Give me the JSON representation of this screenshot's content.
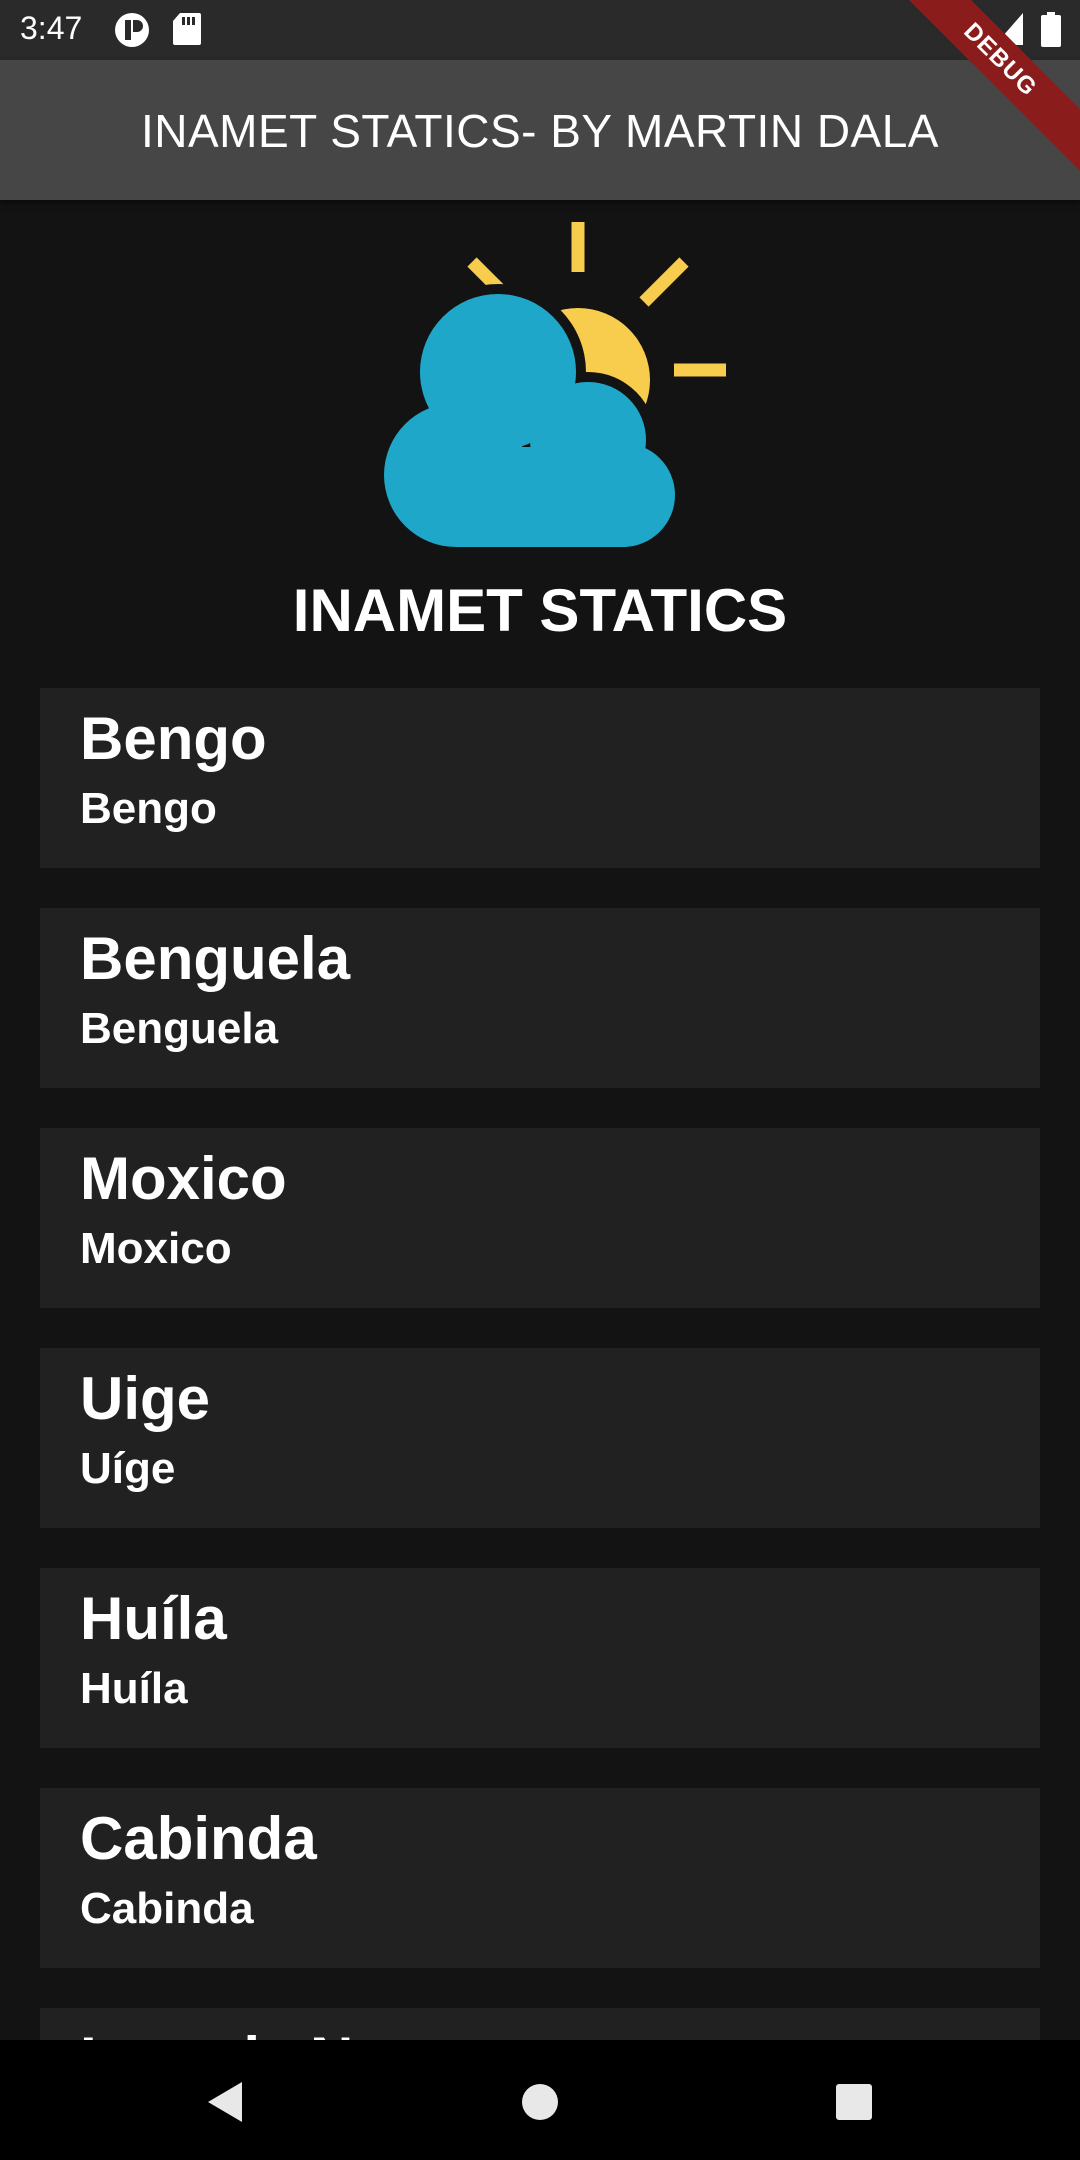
{
  "status_bar": {
    "time": "3:47",
    "icons": [
      "app-indicator-icon",
      "sd-card-icon",
      "wifi-icon",
      "signal-icon",
      "battery-icon"
    ],
    "debug_label": "DEBUG"
  },
  "app_bar": {
    "title": "INAMET STATICS- BY MARTIN DALA"
  },
  "header": {
    "logo_icon": "sun-cloud-icon",
    "title": "INAMET STATICS"
  },
  "provinces": [
    {
      "title": "Bengo",
      "subtitle": "Bengo"
    },
    {
      "title": "Benguela",
      "subtitle": "Benguela"
    },
    {
      "title": "Moxico",
      "subtitle": "Moxico"
    },
    {
      "title": "Uige",
      "subtitle": "Uíge"
    },
    {
      "title": "Huíla",
      "subtitle": "Huíla"
    },
    {
      "title": "Cabinda",
      "subtitle": "Cabinda"
    },
    {
      "title": "Luanda N",
      "subtitle": ""
    }
  ],
  "nav_bar": {
    "icons": [
      "back-icon",
      "home-icon",
      "recents-icon"
    ]
  },
  "colors": {
    "background": "#141314",
    "app_bar": "#474647",
    "card": "#222122",
    "sun": "#f8cd4e",
    "cloud": "#1fa7c9",
    "debug": "#8b1c1c"
  }
}
